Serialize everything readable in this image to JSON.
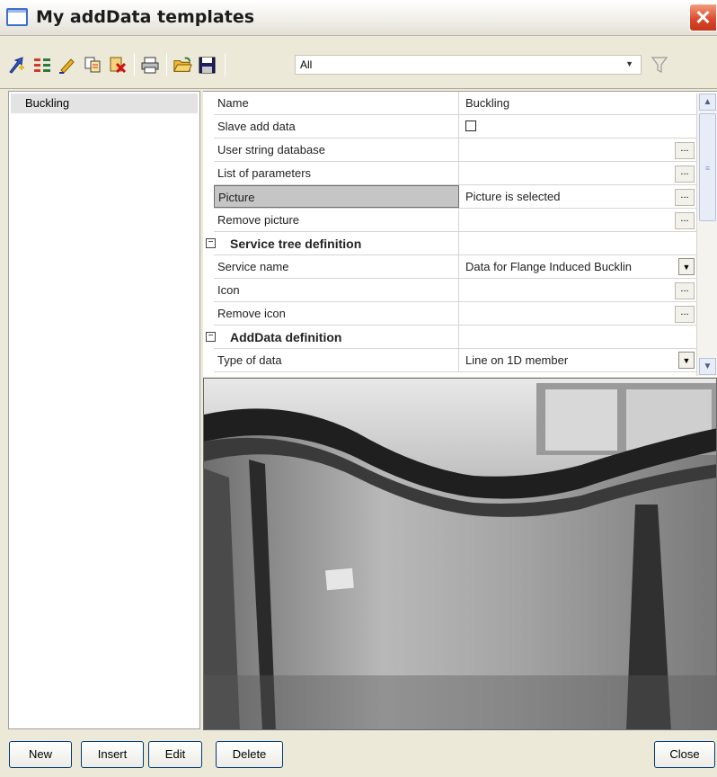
{
  "window": {
    "title": "My addData templates"
  },
  "toolbar": {
    "icons": [
      "new-template-icon",
      "columns-icon",
      "edit-pencil-icon",
      "copy-icon",
      "delete-icon",
      "print-icon",
      "open-folder-icon",
      "save-icon"
    ],
    "filter_value": "All",
    "filter_icon": "filter-funnel-icon"
  },
  "left_list": {
    "items": [
      {
        "label": "Buckling"
      }
    ]
  },
  "properties": {
    "rows": [
      {
        "name": "Name",
        "value": "Buckling"
      },
      {
        "name": "Slave add data",
        "value": ""
      },
      {
        "name": "User string database",
        "value": ""
      },
      {
        "name": "List of parameters",
        "value": ""
      },
      {
        "name": "Picture",
        "value": "Picture is selected"
      },
      {
        "name": "Remove picture",
        "value": ""
      },
      {
        "name": "Service tree definition",
        "value": ""
      },
      {
        "name": "Service name",
        "value": "Data for Flange Induced Bucklin"
      },
      {
        "name": "Icon",
        "value": ""
      },
      {
        "name": "Remove icon",
        "value": ""
      },
      {
        "name": "AddData definition",
        "value": ""
      },
      {
        "name": "Type of data",
        "value": "Line on 1D member"
      }
    ]
  },
  "buttons": {
    "new": "New",
    "insert": "Insert",
    "edit": "Edit",
    "delete": "Delete",
    "close": "Close"
  },
  "colors": {
    "title_close": "#d9462a",
    "window_bg": "#ece9d8",
    "selected_row": "#c5c5c5"
  }
}
